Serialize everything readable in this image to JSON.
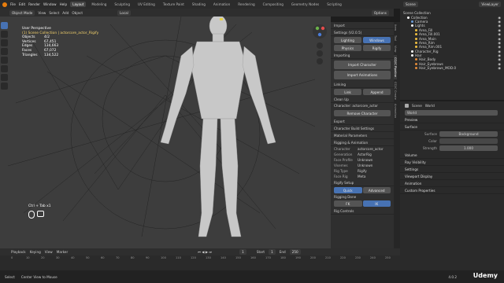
{
  "menu": [
    "File",
    "Edit",
    "Render",
    "Window",
    "Help"
  ],
  "workspaces": [
    "Layout",
    "Modeling",
    "Sculpting",
    "UV Editing",
    "Texture Paint",
    "Shading",
    "Animation",
    "Rendering",
    "Compositing",
    "Geometry Nodes",
    "Scripting"
  ],
  "active_workspace": "Layout",
  "scene": "Scene",
  "view_layer": "ViewLayer",
  "viewport_header": {
    "mode": "Object Mode",
    "view": "View",
    "select": "Select",
    "add": "Add",
    "object": "Object",
    "orientation": "Local",
    "options": "Options"
  },
  "overlay": {
    "title": "User Perspective",
    "subtitle": "(1) Scene Collection | actorcore_actor_Rigify",
    "stats": [
      {
        "k": "Objects",
        "v": "4/2"
      },
      {
        "k": "Vertices",
        "v": "67,451"
      },
      {
        "k": "Edges",
        "v": "134,663"
      },
      {
        "k": "Faces",
        "v": "67,072"
      },
      {
        "k": "Triangles",
        "v": "134,522"
      }
    ]
  },
  "shortcut_hint": "Ctrl + Tab x1",
  "npanel": {
    "import_hdr": "Import",
    "settings": "Settings (V2.0.5)",
    "lighting": "Lighting",
    "windows": "Windows",
    "physics": "Physics",
    "rigify": "Rigify",
    "importing": "Importing",
    "import_character": "Import Character",
    "import_animations": "Import Animations",
    "linking": "Linking",
    "link": "Link",
    "append": "Append",
    "clean_up": "Clean Up",
    "character_label": "Character: actorcore_actor",
    "remove_character": "Remove Character",
    "export": "Export",
    "char_build": "Character Build Settings",
    "material_params": "Material Parameters",
    "rigging": "Rigging & Animation",
    "info": [
      {
        "k": "Character",
        "v": "actorcore_actor"
      },
      {
        "k": "Generation",
        "v": "ActorRig"
      },
      {
        "k": "Face Profile",
        "v": "Unknown"
      },
      {
        "k": "Visemes",
        "v": "Unknown"
      },
      {
        "k": "Rig Type",
        "v": "Rigify"
      },
      {
        "k": "Face Rig",
        "v": "Meta"
      }
    ],
    "rigify_setup": "Rigify Setup",
    "quick": "Quick",
    "advanced": "Advanced",
    "rigging_done": "Rigging Done",
    "fk": "FK",
    "ik": "IK",
    "rig_controls": "Rig Controls"
  },
  "ntabs": [
    "Item",
    "Tool",
    "View",
    "CC/iC Pipeline",
    "CC/iC Create",
    "Animation"
  ],
  "outliner": {
    "header": "Scene Collection",
    "items": [
      {
        "label": "Collection",
        "depth": 1,
        "color": "#ffffff"
      },
      {
        "label": "Camera",
        "depth": 2,
        "color": "#6a9bd8"
      },
      {
        "label": "Lights",
        "depth": 2,
        "color": "#ffffff"
      },
      {
        "label": "Area_Fill",
        "depth": 3,
        "color": "#f0c040"
      },
      {
        "label": "Area_Fill.001",
        "depth": 3,
        "color": "#f0c040"
      },
      {
        "label": "Area_Main",
        "depth": 3,
        "color": "#f0c040"
      },
      {
        "label": "Area_Rim",
        "depth": 3,
        "color": "#f0c040"
      },
      {
        "label": "Area_Rim.001",
        "depth": 3,
        "color": "#f0c040"
      },
      {
        "label": "Character_Rig",
        "depth": 2,
        "color": "#ffffff"
      },
      {
        "label": "Hair",
        "depth": 2,
        "color": "#ffffff"
      },
      {
        "label": "Hair_Body",
        "depth": 3,
        "color": "#e58c3a"
      },
      {
        "label": "Hair_Eyebrows",
        "depth": 3,
        "color": "#e58c3a"
      },
      {
        "label": "Hair_Eyebrows_MOD.0",
        "depth": 3,
        "color": "#e58c3a"
      }
    ]
  },
  "properties": {
    "scene": "Scene",
    "world": "World",
    "world_name": "World",
    "sections": [
      "Preview",
      "Surface"
    ],
    "surface": {
      "k": "Surface",
      "v": "Background"
    },
    "color": {
      "k": "Color"
    },
    "strength": {
      "k": "Strength",
      "v": "1.000"
    },
    "more": [
      "Volume",
      "Ray Visibility",
      "Settings",
      "Viewport Display",
      "Animation",
      "Custom Properties"
    ]
  },
  "timeline": {
    "playback": "Playback",
    "keying": "Keying",
    "view": "View",
    "marker": "Marker",
    "frame": "1",
    "start_label": "Start",
    "start": "1",
    "end_label": "End",
    "end": "250",
    "ticks": [
      "0",
      "10",
      "20",
      "30",
      "40",
      "50",
      "60",
      "70",
      "80",
      "90",
      "100",
      "110",
      "120",
      "130",
      "140",
      "150",
      "160",
      "170",
      "180",
      "190",
      "200",
      "210",
      "220",
      "230",
      "240",
      "250"
    ]
  },
  "status": {
    "select": "Select",
    "center": "Center View to Mouse",
    "version": "4.0.2"
  },
  "brand": "Udemy"
}
